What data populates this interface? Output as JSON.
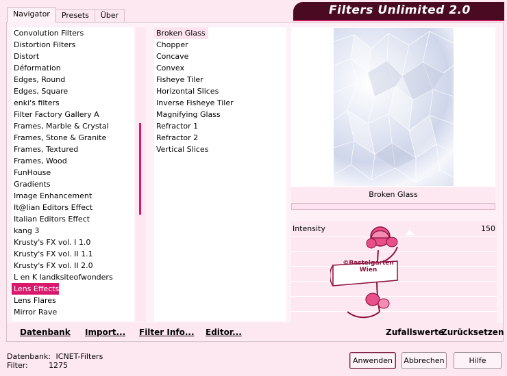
{
  "app": {
    "title": "Filters Unlimited 2.0"
  },
  "tabs": [
    {
      "label": "Navigator",
      "active": true
    },
    {
      "label": "Presets",
      "active": false
    },
    {
      "label": "Über",
      "active": false
    }
  ],
  "categories": [
    "Convolution Filters",
    "Distortion Filters",
    "Distort",
    "Déformation",
    "Edges, Round",
    "Edges, Square",
    "enki's filters",
    "Filter Factory Gallery A",
    "Frames, Marble & Crystal",
    "Frames, Stone & Granite",
    "Frames, Textured",
    "Frames, Wood",
    "FunHouse",
    "Gradients",
    "Image Enhancement",
    "It@lian Editors Effect",
    "Italian Editors Effect",
    "kang 3",
    "Krusty's FX vol. I 1.0",
    "Krusty's FX vol. II 1.1",
    "Krusty's FX vol. II 2.0",
    "L en K landksiteofwonders",
    "Lens Effects",
    "Lens Flares",
    "Mirror Rave"
  ],
  "selected_category": "Lens Effects",
  "filters": [
    "Broken Glass",
    "Chopper",
    "Concave",
    "Convex",
    "Fisheye Tiler",
    "Horizontal Slices",
    "Inverse Fisheye Tiler",
    "Magnifying Glass",
    "Refractor 1",
    "Refractor 2",
    "Vertical Slices"
  ],
  "selected_filter": "Broken Glass",
  "preview": {
    "filter_name": "Broken Glass"
  },
  "params": [
    {
      "label": "Intensity",
      "value": "150"
    }
  ],
  "watermark": {
    "line1": "©Bastelgarten",
    "line2": "Wien"
  },
  "toolbar": {
    "database": "Datenbank",
    "import": "Import...",
    "filter_info": "Filter Info...",
    "editor": "Editor...",
    "random": "Zufallswerte",
    "reset": "Zurücksetzen"
  },
  "status": {
    "db_label": "Datenbank:",
    "db_value": "ICNET-Filters",
    "filter_label": "Filter:",
    "filter_value": "1275"
  },
  "buttons": {
    "apply": "Anwenden",
    "cancel": "Abbrechen",
    "help": "Hilfe"
  },
  "colors": {
    "accent": "#d9186c",
    "title_bg": "#4a0a22",
    "background": "#fde8f1"
  }
}
